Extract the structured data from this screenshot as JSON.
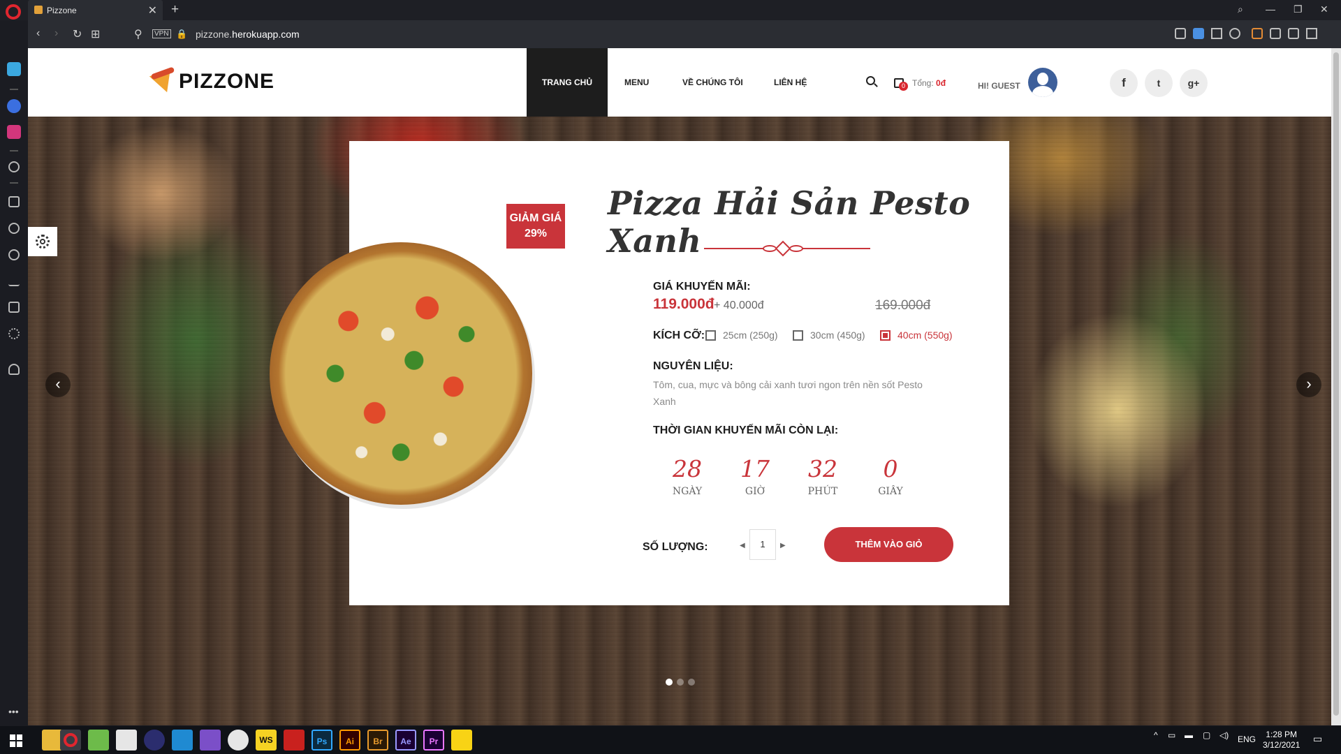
{
  "browser": {
    "tab_title": "Pizzone",
    "close": "✕",
    "new_tab": "+",
    "url_host": "pizzone.",
    "url_domain": "herokuapp.com",
    "vpn": "VPN",
    "window_min": "—",
    "window_restore": "❐",
    "window_close": "✕"
  },
  "header": {
    "logo": "PIZZONE",
    "nav": [
      "TRANG CHỦ",
      "MENU",
      "VỀ CHÚNG TÔI",
      "LIÊN HỆ"
    ],
    "cart_count": "0",
    "total_label": "Tổng:",
    "total_value": "0đ",
    "greeting": "HI! GUEST",
    "social": [
      "f",
      "t",
      "g+"
    ]
  },
  "slider": {
    "prev": "‹",
    "next": "›",
    "slides_count": 3,
    "active_slide": 1
  },
  "product": {
    "discount_label": "GIẢM GIÁ",
    "discount_value": "29%",
    "name": "Pizza Hải Sản Pesto Xanh",
    "promo_price_label": "GIÁ KHUYẾN MÃI:",
    "promo_price": "119.000đ",
    "extra_price": "+ 40.000đ",
    "old_price": "169.000đ",
    "size_label": "KÍCH CỠ:",
    "sizes": [
      {
        "label": "25cm (250g)",
        "selected": false
      },
      {
        "label": "30cm (450g)",
        "selected": false
      },
      {
        "label": "40cm (550g)",
        "selected": true
      }
    ],
    "ingredients_label": "NGUYÊN LIỆU:",
    "ingredients": "Tôm, cua, mực và bông cải xanh tươi ngon trên nền sốt Pesto Xanh",
    "countdown_label": "THỜI GIAN KHUYẾN MÃI CÒN LẠI:",
    "countdown": [
      {
        "value": "28",
        "unit": "NGÀY"
      },
      {
        "value": "17",
        "unit": "GIỜ"
      },
      {
        "value": "32",
        "unit": "PHÚT"
      },
      {
        "value": "0",
        "unit": "GIÂY"
      }
    ],
    "quantity_label": "SỐ LƯỢNG:",
    "quantity": "1",
    "add_to_cart": "THÊM VÀO GIỎ"
  },
  "taskbar": {
    "apps": [
      "file-explorer",
      "opera",
      "notepad",
      "files",
      "eclipse",
      "vscode",
      "visual-studio",
      "wordpress",
      "webstorm",
      "acrobat",
      "photoshop",
      "illustrator",
      "bridge",
      "after-effects",
      "premiere",
      "sticky-notes"
    ],
    "app_labels": {
      "ws": "WS",
      "ps": "Ps",
      "ai": "Ai",
      "br": "Br",
      "ae": "Ae",
      "pr": "Pr"
    },
    "language": "ENG",
    "time": "1:28 PM",
    "date": "3/12/2021"
  },
  "colors": {
    "accent": "#c9343a",
    "header_active": "#1d1d1d",
    "opera_red": "#e0262f"
  }
}
